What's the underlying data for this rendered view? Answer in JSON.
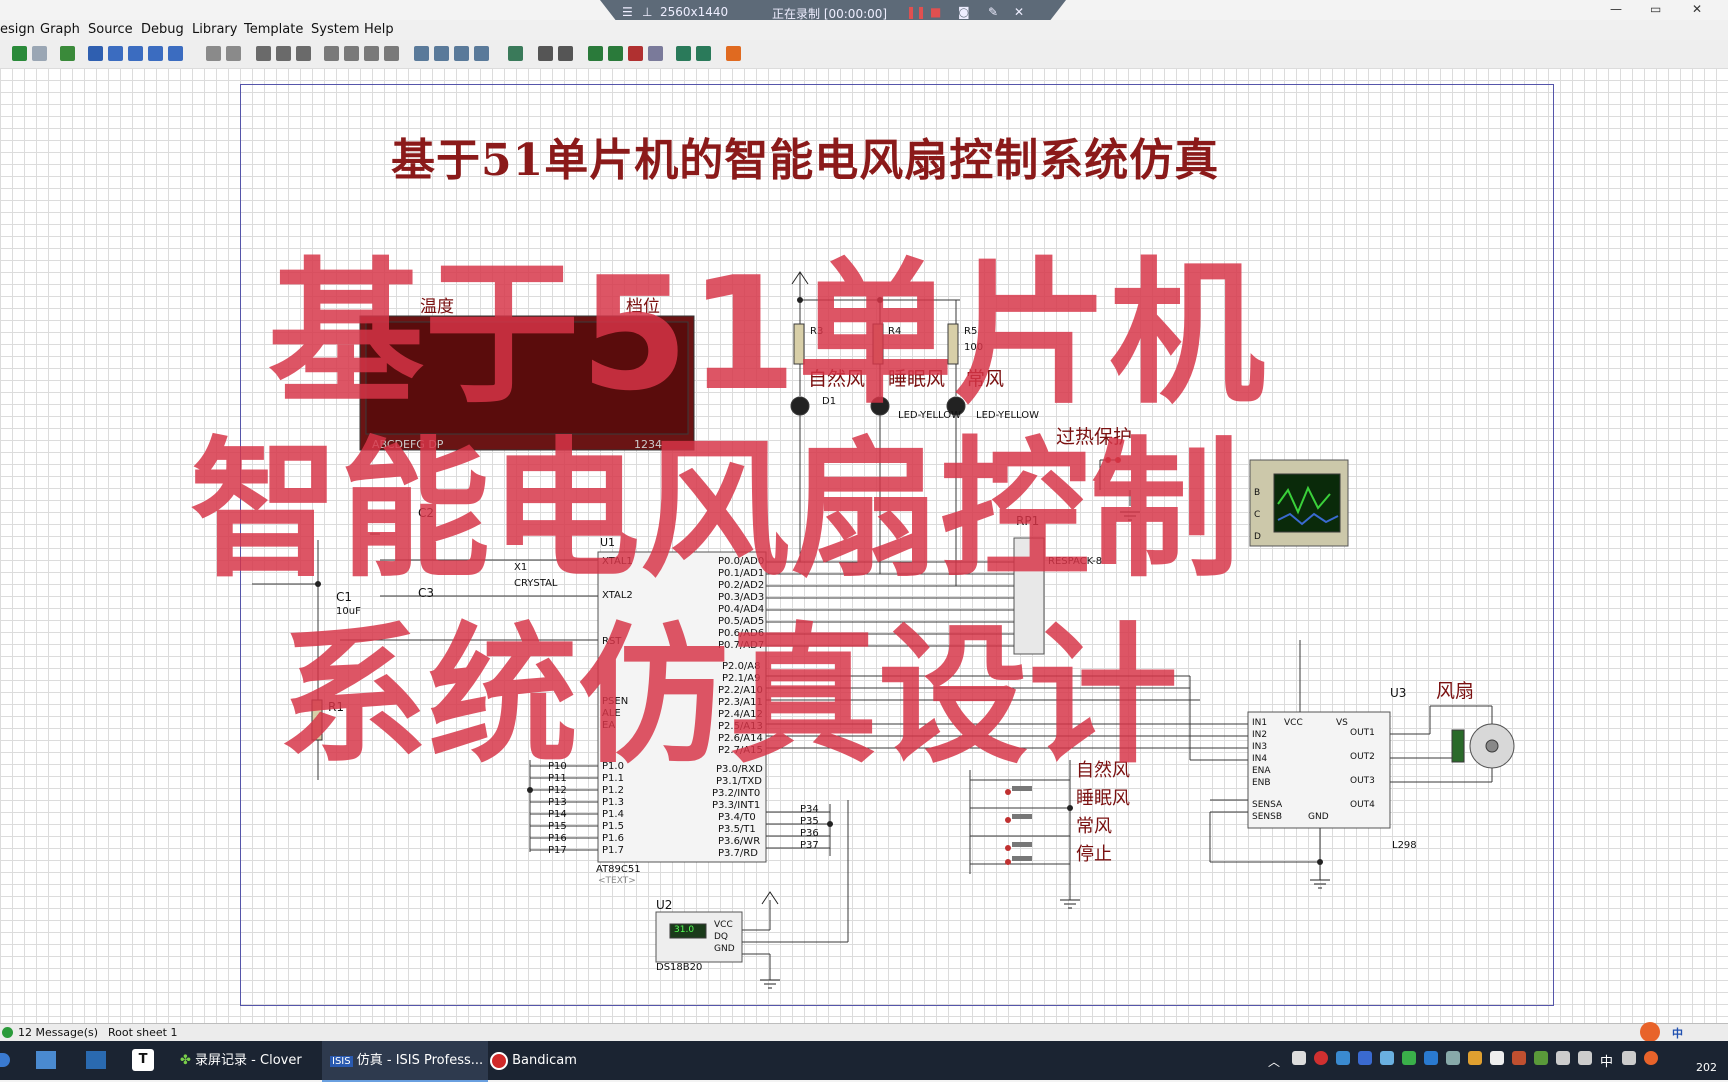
{
  "recorder": {
    "resolution": "2560x1440",
    "status": "正在录制 [00:00:00]"
  },
  "menu": [
    "esign",
    "Graph",
    "Source",
    "Debug",
    "Library",
    "Template",
    "System",
    "Help"
  ],
  "schematic": {
    "title": "基于51单片机的智能电风扇控制系统仿真",
    "display_labels": {
      "temp": "温度",
      "level": "档位",
      "segments": "ABCDEFG DP",
      "digits": "1234"
    },
    "mcu": {
      "ref": "U1",
      "part": "AT89C51",
      "text": "<TEXT>",
      "left_pins": [
        "XTAL1",
        "XTAL2",
        "RST",
        "PSEN",
        "ALE",
        "EA",
        "P1.0",
        "P1.1",
        "P1.2",
        "P1.3",
        "P1.4",
        "P1.5",
        "P1.6",
        "P1.7"
      ],
      "right_pins": [
        "P0.0/AD0",
        "P0.1/AD1",
        "P0.2/AD2",
        "P0.3/AD3",
        "P0.4/AD4",
        "P0.5/AD5",
        "P0.6/AD6",
        "P0.7/AD7",
        "P2.0/A8",
        "P2.1/A9",
        "P2.2/A10",
        "P2.3/A11",
        "P2.4/A12",
        "P2.5/A13",
        "P2.6/A14",
        "P2.7/A15",
        "P3.0/RXD",
        "P3.1/TXD",
        "P3.2/INT0",
        "P3.3/INT1",
        "P3.4/T0",
        "P3.5/T1",
        "P3.6/WR",
        "P3.7/RD"
      ]
    },
    "port_labels": [
      "P10",
      "P11",
      "P12",
      "P13",
      "P14",
      "P15",
      "P16",
      "P17"
    ],
    "p3_labels": [
      "P34",
      "P35",
      "P36",
      "P37"
    ],
    "components": {
      "c1": "C1",
      "c1v": "10uF",
      "c2": "C2",
      "c3": "C3",
      "x1": "X1",
      "crystal": "CRYSTAL",
      "r1": "R1",
      "r3": "R3",
      "r4": "R4",
      "r5": "R5",
      "rval": "100",
      "d1": "D1",
      "led": "LED-YELLOW",
      "rp1": "RP1",
      "respack": "RESPACK-8",
      "u2": "U2",
      "ds": "DS18B20",
      "ds_val": "31.0",
      "vcc": "VCC",
      "dq": "DQ",
      "gnd": "GND",
      "u3": "U3",
      "l298": "L298",
      "scope_labels": [
        "B",
        "C",
        "D"
      ]
    },
    "l298_left": [
      "IN1",
      "IN2",
      "IN3",
      "IN4",
      "ENA",
      "ENB",
      "SENSA",
      "SENSB"
    ],
    "l298_right": [
      "OUT1",
      "OUT2",
      "OUT3",
      "OUT4"
    ],
    "l298_top": {
      "vcc": "VCC",
      "vs": "VS",
      "gnd": "GND"
    },
    "chinese_labels": {
      "natural": "自然风",
      "sleep": "睡眠风",
      "normal": "常风",
      "overheat": "过热保护",
      "fan": "风扇",
      "btn_natural": "自然风",
      "btn_sleep": "睡眠风",
      "btn_normal": "常风",
      "btn_stop": "停止"
    }
  },
  "overlay": {
    "line1": "基于51单片机",
    "line2": "智能电风扇控制",
    "line3": "系统仿真设计"
  },
  "status": {
    "messages": "12 Message(s)",
    "sheet": "Root sheet 1"
  },
  "taskbar": {
    "items": [
      "录屏记录 - Clover",
      "仿真 - ISIS Profess...",
      "Bandicam"
    ],
    "ime": "中",
    "clock": "202"
  },
  "colors": {
    "overlay": "#d63448",
    "title": "#8b1a1a",
    "wire": "#3a3a3a",
    "taskbar": "#1b2432"
  }
}
